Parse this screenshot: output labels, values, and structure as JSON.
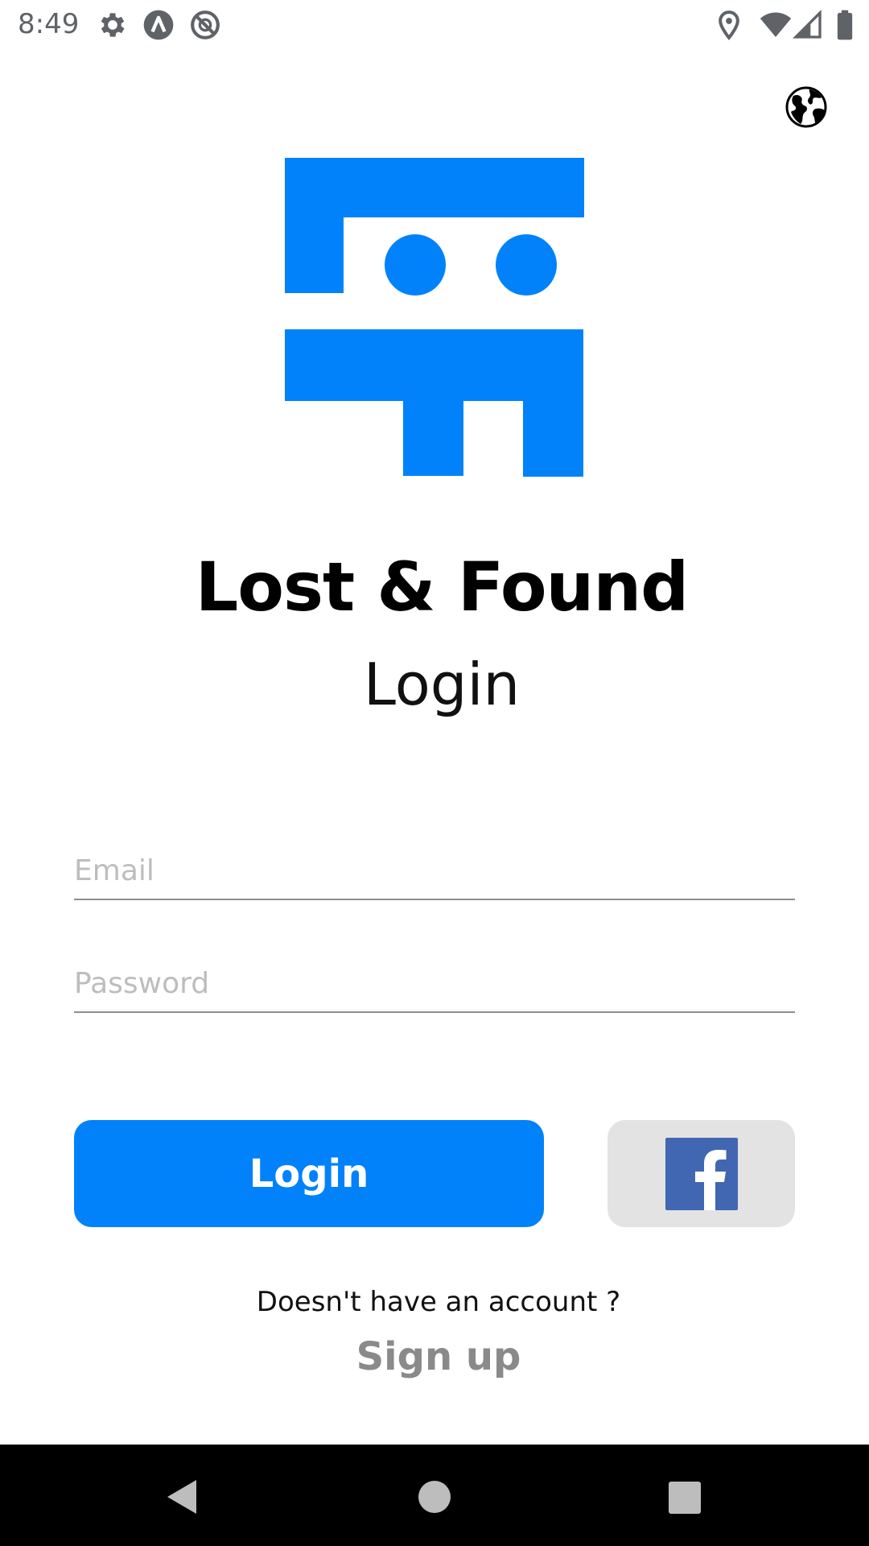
{
  "status_bar": {
    "time": "8:49",
    "left_icons": [
      "settings-icon",
      "android-auto-icon",
      "do-not-disturb-icon"
    ],
    "right_icons": [
      "location-icon",
      "wifi-icon",
      "signal-icon",
      "battery-icon"
    ]
  },
  "header": {
    "language_icon": "globe-icon"
  },
  "brand": {
    "logo_icon": "lost-and-found-logo",
    "logo_color": "#0282fa",
    "app_name": "Lost & Found",
    "screen_title": "Login"
  },
  "form": {
    "email": {
      "value": "",
      "placeholder": "Email"
    },
    "password": {
      "value": "",
      "placeholder": "Password"
    },
    "login_label": "Login",
    "facebook_icon": "facebook-icon",
    "facebook_color": "#4267b2"
  },
  "signup": {
    "prompt": "Doesn't have an account ?",
    "link_label": "Sign up"
  },
  "nav_bar": {
    "buttons": [
      "back-icon",
      "home-icon",
      "recents-icon"
    ]
  },
  "colors": {
    "accent": "#0282fa",
    "secondary_button": "#e3e3e3",
    "link_gray": "#8a8a8a"
  }
}
